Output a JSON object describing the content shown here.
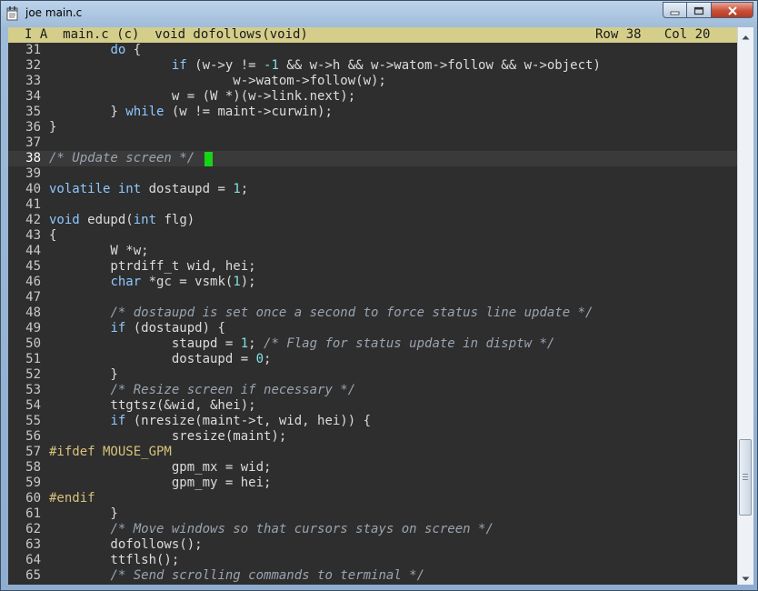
{
  "window": {
    "title": "joe main.c"
  },
  "status": {
    "left": "I A  main.c (c)  void dofollows(void)",
    "right": "Row 38   Col 20"
  },
  "editor": {
    "current_line": 38,
    "lines": [
      {
        "n": "31",
        "tokens": [
          {
            "t": "        "
          },
          {
            "t": "do",
            "c": "kw"
          },
          {
            "t": " {"
          }
        ]
      },
      {
        "n": "32",
        "tokens": [
          {
            "t": "                "
          },
          {
            "t": "if",
            "c": "kw"
          },
          {
            "t": " (w->y != "
          },
          {
            "t": "-1",
            "c": "num"
          },
          {
            "t": " && w->h && w->watom->follow && w->object)"
          }
        ]
      },
      {
        "n": "33",
        "tokens": [
          {
            "t": "                        w->watom->follow(w);"
          }
        ]
      },
      {
        "n": "34",
        "tokens": [
          {
            "t": "                w = (W *)(w->link.next);"
          }
        ]
      },
      {
        "n": "35",
        "tokens": [
          {
            "t": "        } "
          },
          {
            "t": "while",
            "c": "kw"
          },
          {
            "t": " (w != maint->curwin);"
          }
        ]
      },
      {
        "n": "36",
        "tokens": [
          {
            "t": "}"
          }
        ]
      },
      {
        "n": "37",
        "tokens": []
      },
      {
        "n": "38",
        "tokens": [
          {
            "t": "/* Update screen */",
            "c": "comment"
          }
        ]
      },
      {
        "n": "39",
        "tokens": []
      },
      {
        "n": "40",
        "tokens": [
          {
            "t": "volatile",
            "c": "kw"
          },
          {
            "t": " "
          },
          {
            "t": "int",
            "c": "kw"
          },
          {
            "t": " dostaupd = "
          },
          {
            "t": "1",
            "c": "num"
          },
          {
            "t": ";"
          }
        ]
      },
      {
        "n": "41",
        "tokens": []
      },
      {
        "n": "42",
        "tokens": [
          {
            "t": "void",
            "c": "kw"
          },
          {
            "t": " edupd("
          },
          {
            "t": "int",
            "c": "kw"
          },
          {
            "t": " flg)"
          }
        ]
      },
      {
        "n": "43",
        "tokens": [
          {
            "t": "{"
          }
        ]
      },
      {
        "n": "44",
        "tokens": [
          {
            "t": "        W *w;"
          }
        ]
      },
      {
        "n": "45",
        "tokens": [
          {
            "t": "        ptrdiff_t wid, hei;"
          }
        ]
      },
      {
        "n": "46",
        "tokens": [
          {
            "t": "        "
          },
          {
            "t": "char",
            "c": "kw"
          },
          {
            "t": " *gc = vsmk("
          },
          {
            "t": "1",
            "c": "num"
          },
          {
            "t": ");"
          }
        ]
      },
      {
        "n": "47",
        "tokens": []
      },
      {
        "n": "48",
        "tokens": [
          {
            "t": "        "
          },
          {
            "t": "/* dostaupd is set once a second to force status line update */",
            "c": "comment"
          }
        ]
      },
      {
        "n": "49",
        "tokens": [
          {
            "t": "        "
          },
          {
            "t": "if",
            "c": "kw"
          },
          {
            "t": " (dostaupd) {"
          }
        ]
      },
      {
        "n": "50",
        "tokens": [
          {
            "t": "                staupd = "
          },
          {
            "t": "1",
            "c": "num"
          },
          {
            "t": "; "
          },
          {
            "t": "/* Flag for status update in disptw */",
            "c": "comment"
          }
        ]
      },
      {
        "n": "51",
        "tokens": [
          {
            "t": "                dostaupd = "
          },
          {
            "t": "0",
            "c": "num"
          },
          {
            "t": ";"
          }
        ]
      },
      {
        "n": "52",
        "tokens": [
          {
            "t": "        }"
          }
        ]
      },
      {
        "n": "53",
        "tokens": [
          {
            "t": "        "
          },
          {
            "t": "/* Resize screen if necessary */",
            "c": "comment"
          }
        ]
      },
      {
        "n": "54",
        "tokens": [
          {
            "t": "        ttgtsz(&wid, &hei);"
          }
        ]
      },
      {
        "n": "55",
        "tokens": [
          {
            "t": "        "
          },
          {
            "t": "if",
            "c": "kw"
          },
          {
            "t": " (nresize(maint->t, wid, hei)) {"
          }
        ]
      },
      {
        "n": "56",
        "tokens": [
          {
            "t": "                sresize(maint);"
          }
        ]
      },
      {
        "n": "57",
        "tokens": [
          {
            "t": "#ifdef MOUSE_GPM",
            "c": "pre"
          }
        ]
      },
      {
        "n": "58",
        "tokens": [
          {
            "t": "                gpm_mx = wid;"
          }
        ]
      },
      {
        "n": "59",
        "tokens": [
          {
            "t": "                gpm_my = hei;"
          }
        ]
      },
      {
        "n": "60",
        "tokens": [
          {
            "t": "#endif",
            "c": "pre"
          }
        ]
      },
      {
        "n": "61",
        "tokens": [
          {
            "t": "        }"
          }
        ]
      },
      {
        "n": "62",
        "tokens": [
          {
            "t": "        "
          },
          {
            "t": "/* Move windows so that cursors stays on screen */",
            "c": "comment"
          }
        ]
      },
      {
        "n": "63",
        "tokens": [
          {
            "t": "        dofollows();"
          }
        ]
      },
      {
        "n": "64",
        "tokens": [
          {
            "t": "        ttflsh();"
          }
        ]
      },
      {
        "n": "65",
        "tokens": [
          {
            "t": "        "
          },
          {
            "t": "/* Send scrolling commands to terminal */",
            "c": "comment"
          }
        ]
      }
    ]
  },
  "scrollbar": {
    "position": 0.88
  },
  "icons": {
    "app": "notepad-app-icon",
    "minimize": "minimize-icon",
    "maximize": "maximize-icon",
    "close": "close-icon",
    "scroll_up": "scroll-up-arrow-icon",
    "scroll_down": "scroll-down-arrow-icon"
  }
}
